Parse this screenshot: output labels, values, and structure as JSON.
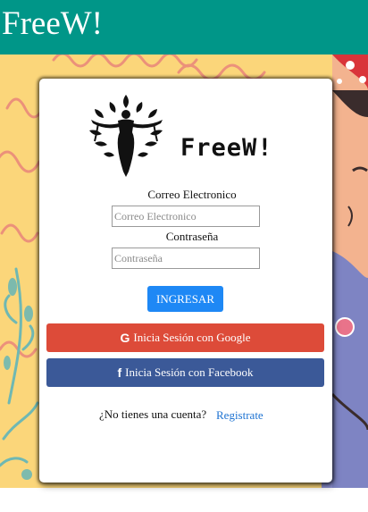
{
  "header": {
    "title": "FreeW!",
    "color": "#009688"
  },
  "logo": {
    "wordmark": "FreeW!"
  },
  "form": {
    "email_label": "Correo Electronico",
    "email_placeholder": "Correo Electronico",
    "email_value": "",
    "password_label": "Contraseña",
    "password_placeholder": "Contraseña",
    "password_value": "",
    "submit_label": "INGRESAR"
  },
  "social": {
    "google_label": "Inicia Sesión con Google",
    "google_icon": "google-icon",
    "google_color": "#dd4b39",
    "facebook_label": "Inicia Sesión con Facebook",
    "facebook_icon": "facebook-icon",
    "facebook_color": "#3b5998"
  },
  "signup": {
    "question": "¿No tienes una cuenta?",
    "link_label": "Registrate"
  },
  "colors": {
    "accent": "#1e88f5",
    "background_art": "#fbd67a"
  }
}
